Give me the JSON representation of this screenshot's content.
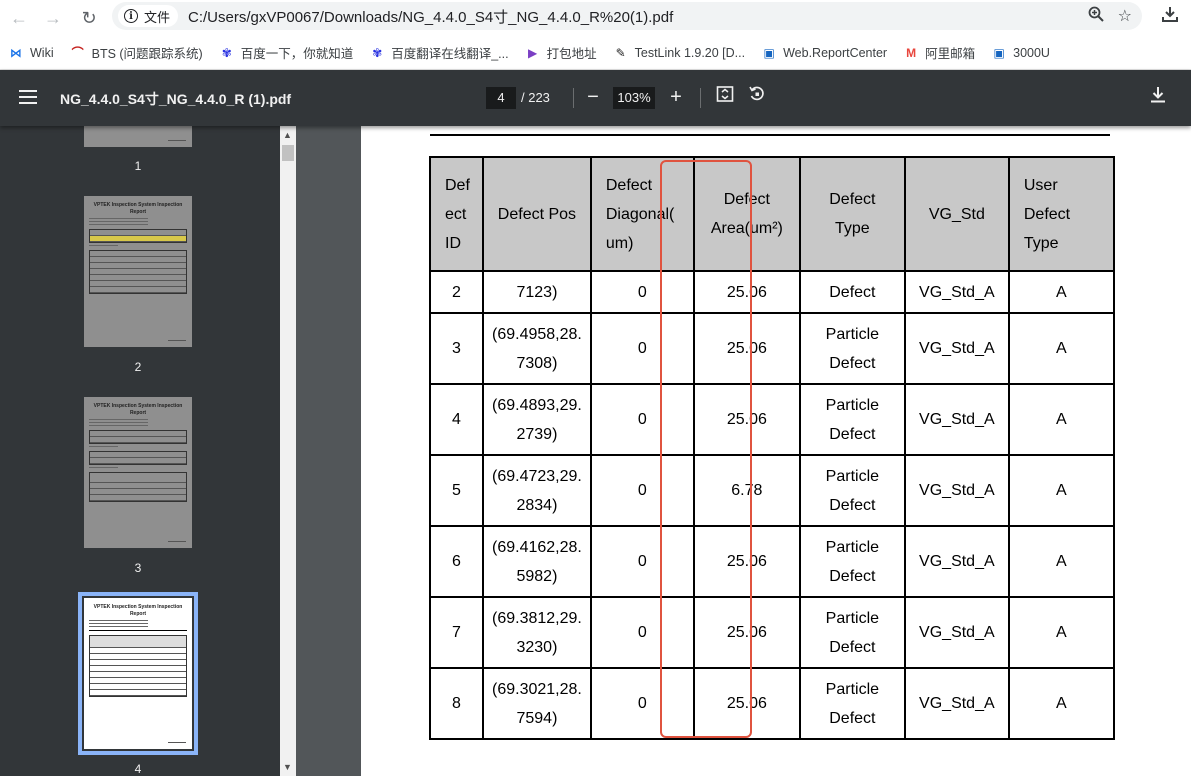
{
  "browser": {
    "file_chip_label": "文件",
    "url": "C:/Users/gxVP0067/Downloads/NG_4.4.0_S4寸_NG_4.4.0_R%20(1).pdf",
    "bookmarks": [
      {
        "label": "Wiki",
        "icon": "wiki-icon",
        "color": "#1a73e8"
      },
      {
        "label": "BTS (问题跟踪系统)",
        "icon": "bts-icon",
        "color": "#c5221f"
      },
      {
        "label": "百度一下，你就知道",
        "icon": "baidu-paw-icon",
        "color": "#2932e1"
      },
      {
        "label": "百度翻译在线翻译_...",
        "icon": "baidu-paw-icon",
        "color": "#2932e1"
      },
      {
        "label": "打包地址",
        "icon": "play-icon",
        "color": "#7b3fc4"
      },
      {
        "label": "TestLink 1.9.20 [D...",
        "icon": "testlink-icon",
        "color": "#222222"
      },
      {
        "label": "Web.ReportCenter",
        "icon": "monitor-icon",
        "color": "#1565c0"
      },
      {
        "label": "阿里邮箱",
        "icon": "mail-m-icon",
        "color": "#e8453c"
      },
      {
        "label": "3000U",
        "icon": "monitor-icon",
        "color": "#1565c0"
      }
    ]
  },
  "pdf": {
    "title": "NG_4.4.0_S4寸_NG_4.4.0_R (1).pdf",
    "current_page": "4",
    "total_pages": "/ 223",
    "zoom": "103%"
  },
  "sidebar": {
    "thumb_title": "VPTEK Inspection System Inspection Report",
    "thumbnails": [
      {
        "number": "1"
      },
      {
        "number": "2"
      },
      {
        "number": "3"
      },
      {
        "number": "4",
        "selected": true
      }
    ]
  },
  "table": {
    "headers": [
      [
        "Def",
        "ect",
        "ID"
      ],
      [
        "Defect Pos"
      ],
      [
        "Defect",
        "Diagonal(",
        "um)"
      ],
      [
        "Defect",
        "Area(um²)"
      ],
      [
        "Defect",
        "Type"
      ],
      [
        "VG_Std"
      ],
      [
        "User",
        "Defect",
        "Type"
      ]
    ],
    "rows": [
      {
        "id": "2",
        "pos": [
          "7123)"
        ],
        "diagonal": "0",
        "area": "25.06",
        "type": [
          "Defect"
        ],
        "std": "VG_Std_A",
        "user_type": "A"
      },
      {
        "id": "3",
        "pos": [
          "(69.4958,28.",
          "7308)"
        ],
        "diagonal": "0",
        "area": "25.06",
        "type": [
          "Particle",
          "Defect"
        ],
        "std": "VG_Std_A",
        "user_type": "A"
      },
      {
        "id": "4",
        "pos": [
          "(69.4893,29.",
          "2739)"
        ],
        "diagonal": "0",
        "area": "25.06",
        "type": [
          "Particle",
          "Defect"
        ],
        "std": "VG_Std_A",
        "user_type": "A"
      },
      {
        "id": "5",
        "pos": [
          "(69.4723,29.",
          "2834)"
        ],
        "diagonal": "0",
        "area": "6.78",
        "type": [
          "Particle",
          "Defect"
        ],
        "std": "VG_Std_A",
        "user_type": "A"
      },
      {
        "id": "6",
        "pos": [
          "(69.4162,28.",
          "5982)"
        ],
        "diagonal": "0",
        "area": "25.06",
        "type": [
          "Particle",
          "Defect"
        ],
        "std": "VG_Std_A",
        "user_type": "A"
      },
      {
        "id": "7",
        "pos": [
          "(69.3812,29.",
          "3230)"
        ],
        "diagonal": "0",
        "area": "25.06",
        "type": [
          "Particle",
          "Defect"
        ],
        "std": "VG_Std_A",
        "user_type": "A"
      },
      {
        "id": "8",
        "pos": [
          "(69.3021,28.",
          "7594)"
        ],
        "diagonal": "0",
        "area": "25.06",
        "type": [
          "Particle",
          "Defect"
        ],
        "std": "VG_Std_A",
        "user_type": "A"
      }
    ]
  }
}
